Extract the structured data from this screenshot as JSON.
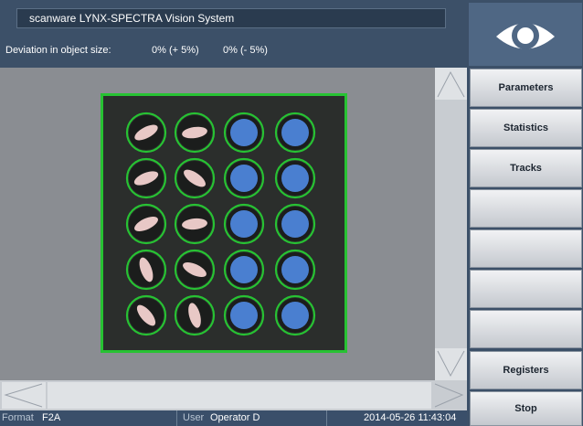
{
  "window": {
    "title": "scanware LYNX-SPECTRA Vision System"
  },
  "deviation": {
    "label": "Deviation in object size:",
    "plus": "0% (+ 5%)",
    "minus": "0% (- 5%)"
  },
  "colors": {
    "frame": "#3c5068",
    "detection_ring": "#27c233",
    "tablet_blue": "#4a7fd0",
    "tablet_pink": "#e8c8c6"
  },
  "image": {
    "rows": [
      [
        "capsule",
        "capsule",
        "round",
        "round"
      ],
      [
        "capsule",
        "capsule",
        "round",
        "round"
      ],
      [
        "capsule",
        "capsule",
        "round",
        "round"
      ],
      [
        "capsule",
        "capsule",
        "round",
        "round"
      ],
      [
        "capsule",
        "capsule",
        "round",
        "round"
      ]
    ]
  },
  "buttons": [
    "Parameters",
    "Statistics",
    "Tracks",
    "",
    "",
    "",
    "",
    "Registers",
    "Stop"
  ],
  "status": {
    "format_label": "Format",
    "format_value": "F2A",
    "user_label": "User",
    "user_value": "Operator D",
    "datetime": "2014-05-26 11:43:04"
  }
}
